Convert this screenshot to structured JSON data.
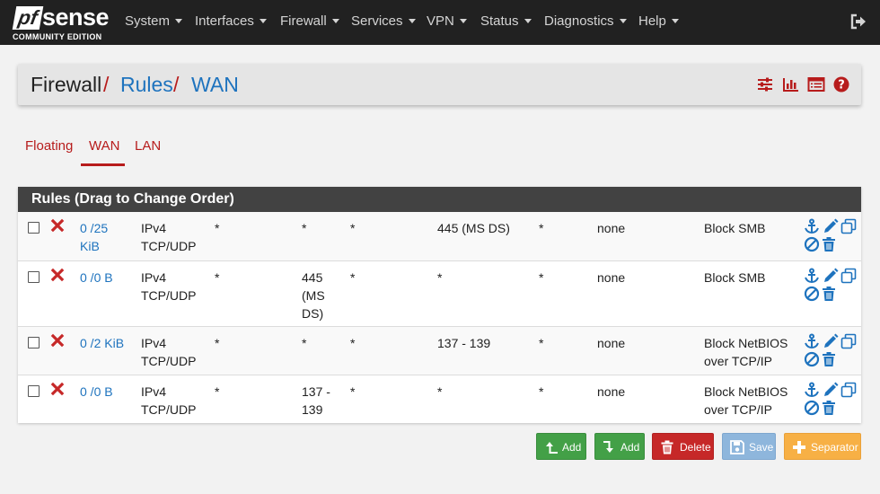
{
  "brand": {
    "logo_pf": "pf",
    "logo_sense": "sense",
    "edition": "COMMUNITY EDITION"
  },
  "nav": [
    {
      "label": "System"
    },
    {
      "label": "Interfaces"
    },
    {
      "label": "Firewall"
    },
    {
      "label": "Services"
    },
    {
      "label": "VPN"
    },
    {
      "label": "Status"
    },
    {
      "label": "Diagnostics"
    },
    {
      "label": "Help"
    }
  ],
  "breadcrumb": {
    "root": "Firewall",
    "sep": "/",
    "section": "Rules",
    "page": "WAN"
  },
  "header_icons": [
    "sliders-icon",
    "bar-chart-icon",
    "table-list-icon",
    "help-icon"
  ],
  "tabs": [
    {
      "label": "Floating"
    },
    {
      "label": "WAN",
      "active": true
    },
    {
      "label": "LAN"
    }
  ],
  "panel": {
    "title": "Rules (Drag to Change Order)"
  },
  "rules": [
    {
      "states": "0 /25 KiB",
      "states_l1": "0 /25",
      "states_l2": "KiB",
      "proto_l1": "IPv4",
      "proto_l2": "TCP/UDP",
      "source": "*",
      "src_port": "*",
      "src_port_l1": "*",
      "src_port_l2": "",
      "src_port_l3": "",
      "destination": "*",
      "dst_port": "445 (MS DS)",
      "gateway": "*",
      "queue": "none",
      "description": "Block SMB",
      "desc_l1": "Block SMB",
      "desc_l2": ""
    },
    {
      "states": "0 /0 B",
      "states_l1": "0 /0 B",
      "states_l2": "",
      "proto_l1": "IPv4",
      "proto_l2": "TCP/UDP",
      "source": "*",
      "src_port": "445 (MS DS)",
      "src_port_l1": "445",
      "src_port_l2": "(MS",
      "src_port_l3": "DS)",
      "destination": "*",
      "dst_port": "*",
      "gateway": "*",
      "queue": "none",
      "description": "Block SMB",
      "desc_l1": "Block SMB",
      "desc_l2": ""
    },
    {
      "states": "0 /2 KiB",
      "states_l1": "0 /2 KiB",
      "states_l2": "",
      "proto_l1": "IPv4",
      "proto_l2": "TCP/UDP",
      "source": "*",
      "src_port": "*",
      "src_port_l1": "*",
      "src_port_l2": "",
      "src_port_l3": "",
      "destination": "*",
      "dst_port": "137 - 139",
      "gateway": "*",
      "queue": "none",
      "description": "Block NetBIOS over TCP/IP",
      "desc_l1": "Block NetBIOS",
      "desc_l2": "over TCP/IP"
    },
    {
      "states": "0 /0 B",
      "states_l1": "0 /0 B",
      "states_l2": "",
      "proto_l1": "IPv4",
      "proto_l2": "TCP/UDP",
      "source": "*",
      "src_port": "137 - 139",
      "src_port_l1": "137 -",
      "src_port_l2": "139",
      "src_port_l3": "",
      "destination": "*",
      "dst_port": "*",
      "gateway": "*",
      "queue": "none",
      "description": "Block NetBIOS over TCP/IP",
      "desc_l1": "Block NetBIOS",
      "desc_l2": "over TCP/IP"
    }
  ],
  "buttons": {
    "add_top": "Add",
    "add_bottom": "Add",
    "delete": "Delete",
    "save": "Save",
    "separator": "Separator"
  },
  "colors": {
    "navbar": "#212121",
    "accent_red": "#b71c1c",
    "link_blue": "#1e73be",
    "panel_head": "#424242",
    "green": "#43a047",
    "red": "#c62828",
    "blue": "#8eb6dc",
    "orange": "#f7b045"
  }
}
